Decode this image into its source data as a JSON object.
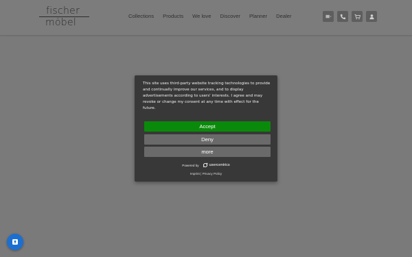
{
  "header": {
    "logo_line1": "fischer",
    "logo_line2": "möbel",
    "nav": [
      "Collections",
      "Products",
      "We love",
      "Discover",
      "Planner",
      "Dealer"
    ],
    "icons": [
      "language-flag-icon",
      "phone-icon",
      "cart-icon",
      "user-icon"
    ],
    "language_label": "⚐▾"
  },
  "consent": {
    "text": "This site uses third-party website tracking technologies to provide and continually improve our services, and to display advertisements according to users' interests. I agree and may revoke or change my consent at any time with effect for the future.",
    "accept_label": "Accept",
    "deny_label": "Deny",
    "more_label": "more",
    "powered_by": "Powered by",
    "brand": "usercentrics",
    "imprint_label": "Imprint",
    "separator": "|",
    "privacy_label": "Privacy Policy",
    "accept_color": "#0a8a0a",
    "button_color": "#6a6a6a",
    "dialog_color": "#383838"
  },
  "floating_button": {
    "icon": "privacy-settings-icon",
    "color": "#1c6fd1"
  }
}
